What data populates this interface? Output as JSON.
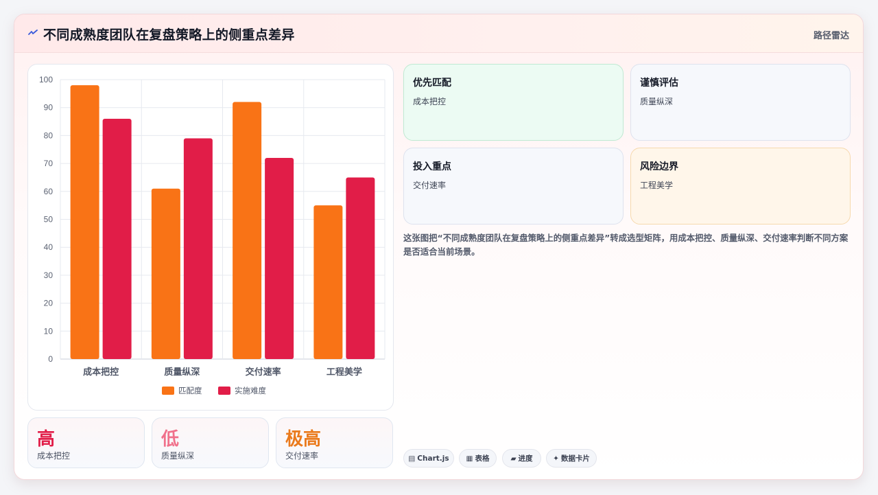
{
  "header": {
    "title": "不同成熟度团队在复盘策略上的侧重点差异",
    "mode_label": "路径雷达",
    "icon": "spark-icon"
  },
  "chart_data": {
    "type": "bar",
    "categories": [
      "成本把控",
      "质量纵深",
      "交付速率",
      "工程美学"
    ],
    "series": [
      {
        "name": "匹配度",
        "values": [
          98,
          61,
          92,
          55
        ],
        "color": "#f97316"
      },
      {
        "name": "实施难度",
        "values": [
          86,
          79,
          72,
          65
        ],
        "color": "#e11d48"
      }
    ],
    "ylim": [
      0,
      100
    ],
    "yticks": [
      0,
      10,
      20,
      30,
      40,
      50,
      60,
      70,
      80,
      90,
      100
    ],
    "grid": true,
    "legend_position": "bottom"
  },
  "stats": [
    {
      "value": "高",
      "label": "成本把控",
      "color": "#e11d48"
    },
    {
      "value": "低",
      "label": "质量纵深",
      "color": "#f0718b"
    },
    {
      "value": "极高",
      "label": "交付速率",
      "color": "#ea7a1c"
    }
  ],
  "tiles": [
    {
      "title": "优先匹配",
      "subtitle": "成本把控",
      "bg": "#ecfbf3",
      "border": "#bfe9d2"
    },
    {
      "title": "谨慎评估",
      "subtitle": "质量纵深",
      "bg": "#f6f8fc",
      "border": "#dde2ee"
    },
    {
      "title": "投入重点",
      "subtitle": "交付速率",
      "bg": "#f6f8fc",
      "border": "#dde2ee"
    },
    {
      "title": "风险边界",
      "subtitle": "工程美学",
      "bg": "#fff6ea",
      "border": "#f6d9ad"
    }
  ],
  "description": "这张图把“不同成熟度团队在复盘策略上的侧重点差异”转成选型矩阵，用成本把控、质量纵深、交付速率判断不同方案是否适合当前场景。",
  "tags": [
    {
      "icon": "table-icon",
      "glyph": "▤",
      "label": "Chart.js"
    },
    {
      "icon": "grid-icon",
      "glyph": "▦",
      "label": "表格"
    },
    {
      "icon": "progress-icon",
      "glyph": "▰",
      "label": "进度"
    },
    {
      "icon": "sparkle-icon",
      "glyph": "✦",
      "label": "数据卡片"
    }
  ]
}
